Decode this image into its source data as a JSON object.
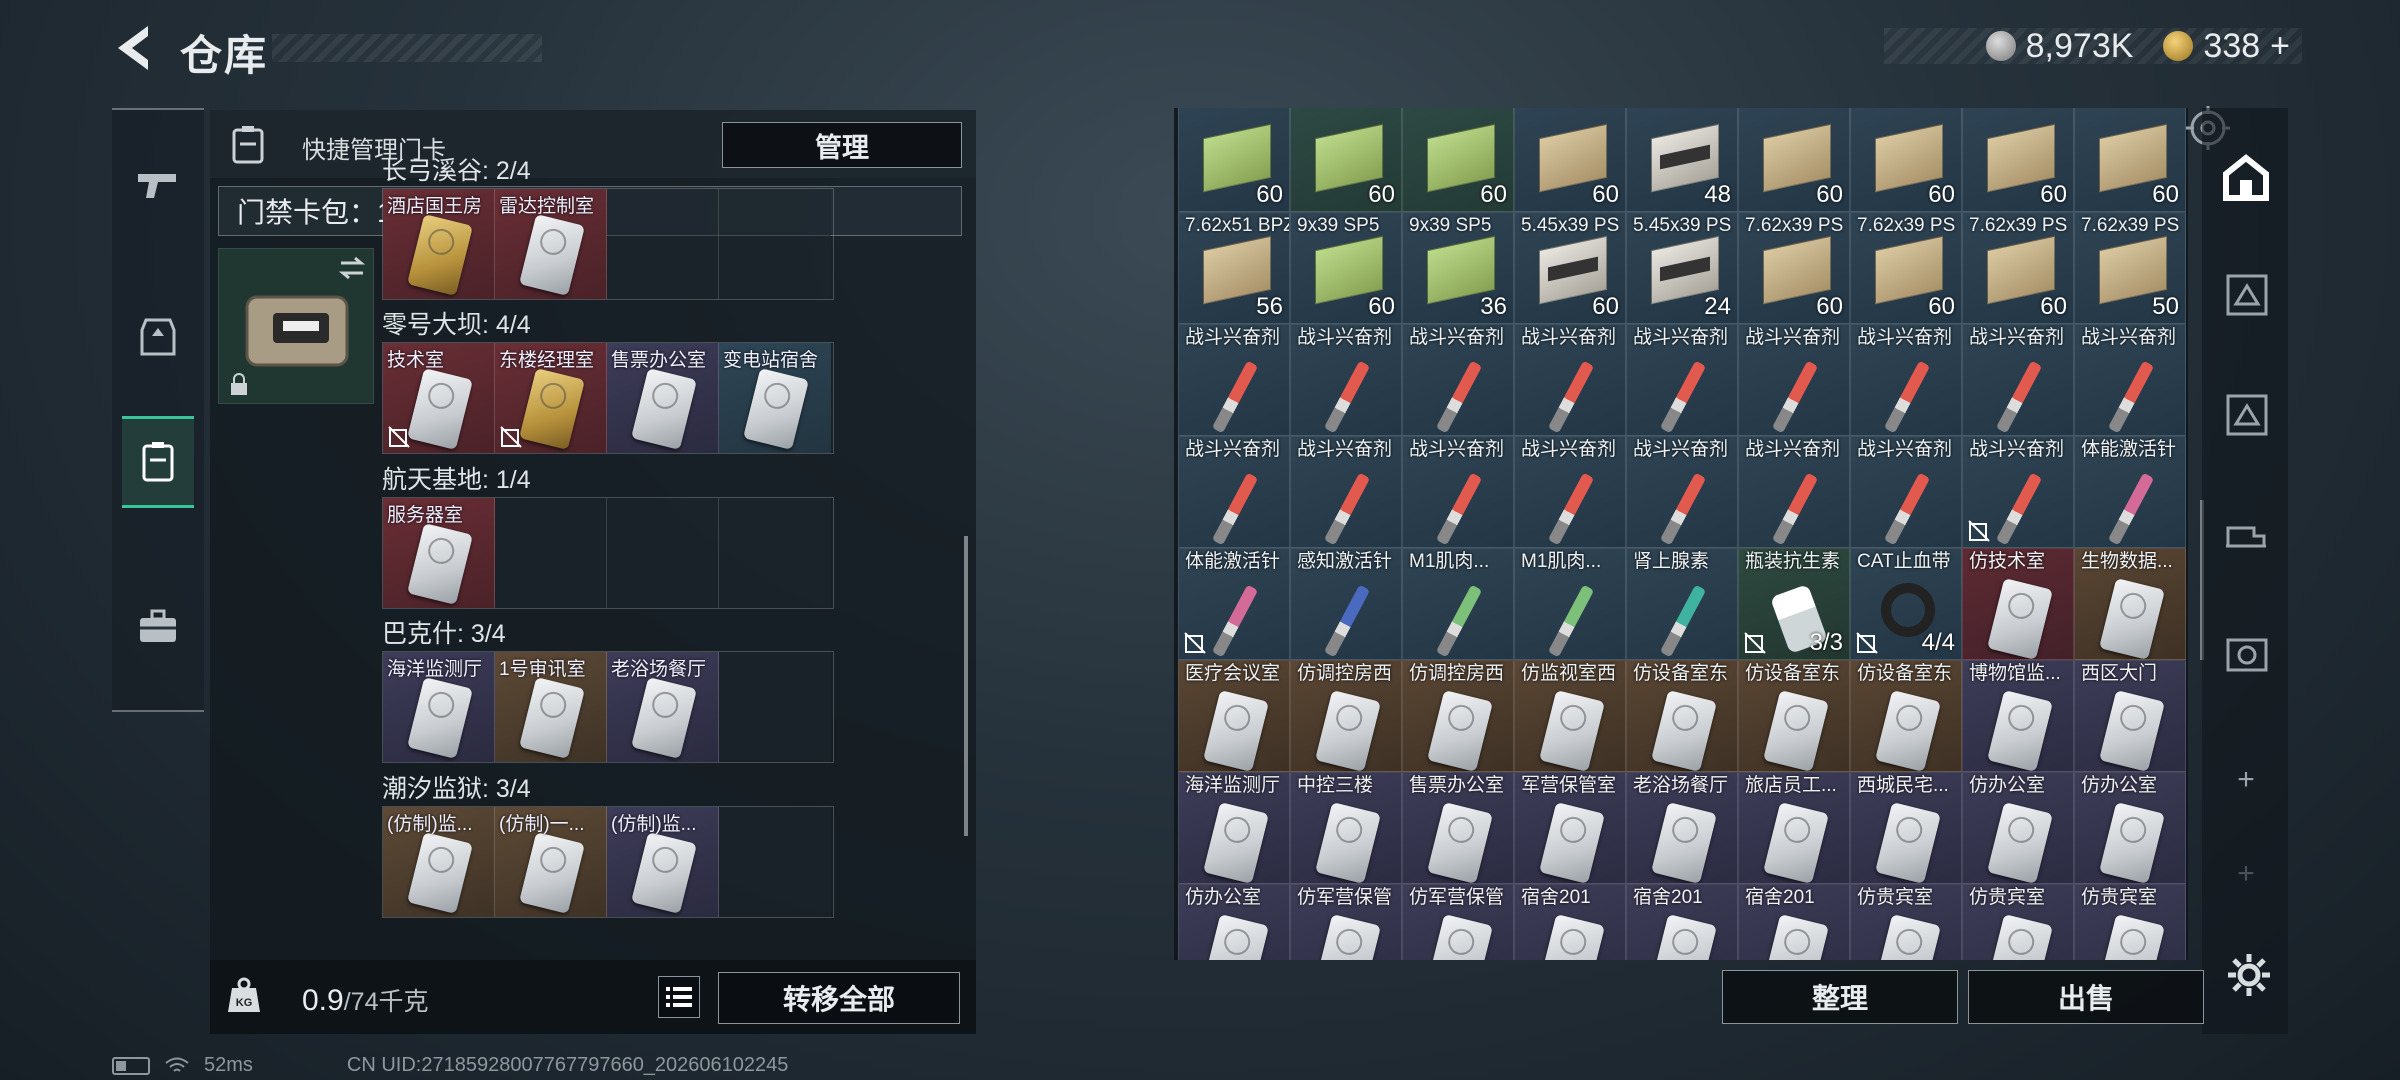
{
  "header": {
    "title": "仓库",
    "silver_value": "8,973K",
    "gold_value": "338",
    "gold_plus": "+"
  },
  "quick_panel": {
    "title": "快捷管理门卡",
    "manage_label": "管理",
    "cardpack_label": "门禁卡包：13/20",
    "help_label": "?"
  },
  "regions": [
    {
      "label": "长弓溪谷: 2/4",
      "slots": [
        {
          "name": "酒店国王房",
          "color": "red",
          "card": "gold",
          "nodrop": false
        },
        {
          "name": "雷达控制室",
          "color": "red",
          "card": "white",
          "nodrop": false
        },
        {
          "name": "",
          "color": "empty"
        },
        {
          "name": "",
          "color": "empty"
        }
      ]
    },
    {
      "label": "零号大坝: 4/4",
      "slots": [
        {
          "name": "技术室",
          "color": "red",
          "card": "white",
          "nodrop": true
        },
        {
          "name": "东楼经理室",
          "color": "red",
          "card": "gold",
          "nodrop": true
        },
        {
          "name": "售票办公室",
          "color": "purple",
          "card": "white",
          "nodrop": false
        },
        {
          "name": "变电站宿舍",
          "color": "blue",
          "card": "white",
          "nodrop": false
        }
      ]
    },
    {
      "label": "航天基地: 1/4",
      "slots": [
        {
          "name": "服务器室",
          "color": "red",
          "card": "white",
          "nodrop": false
        },
        {
          "name": "",
          "color": "empty"
        },
        {
          "name": "",
          "color": "empty"
        },
        {
          "name": "",
          "color": "empty"
        }
      ]
    },
    {
      "label": "巴克什: 3/4",
      "slots": [
        {
          "name": "海洋监测厅",
          "color": "purple",
          "card": "white",
          "nodrop": false
        },
        {
          "name": "1号审讯室",
          "color": "brown",
          "card": "white",
          "nodrop": false
        },
        {
          "name": "老浴场餐厅",
          "color": "purple",
          "card": "white",
          "nodrop": false
        },
        {
          "name": "",
          "color": "empty"
        }
      ]
    },
    {
      "label": "潮汐监狱: 3/4",
      "slots": [
        {
          "name": "(仿制)监...",
          "color": "brown",
          "card": "white",
          "nodrop": false
        },
        {
          "name": "(仿制)一...",
          "color": "brown",
          "card": "white",
          "nodrop": false
        },
        {
          "name": "(仿制)监...",
          "color": "purple",
          "card": "white",
          "nodrop": false
        },
        {
          "name": "",
          "color": "empty"
        }
      ]
    }
  ],
  "bottom": {
    "weight_value": "0.9",
    "weight_unit": "/74千克",
    "transfer_label": "转移全部"
  },
  "status": {
    "ping": "52ms",
    "uid": "CN UID:27185928007767797660_202606102245"
  },
  "inventory": [
    {
      "name": "",
      "count": "60",
      "kind": "ammo",
      "c": "c-blue",
      "variant": "green"
    },
    {
      "name": "",
      "count": "60",
      "kind": "ammo",
      "c": "c-green",
      "variant": "green"
    },
    {
      "name": "",
      "count": "60",
      "kind": "ammo",
      "c": "c-green",
      "variant": "green"
    },
    {
      "name": "",
      "count": "60",
      "kind": "ammo",
      "c": "c-blue",
      "variant": ""
    },
    {
      "name": "",
      "count": "48",
      "kind": "ammo",
      "c": "c-blue",
      "variant": "dark"
    },
    {
      "name": "",
      "count": "60",
      "kind": "ammo",
      "c": "c-blue",
      "variant": ""
    },
    {
      "name": "",
      "count": "60",
      "kind": "ammo",
      "c": "c-blue",
      "variant": ""
    },
    {
      "name": "",
      "count": "60",
      "kind": "ammo",
      "c": "c-blue",
      "variant": ""
    },
    {
      "name": "",
      "count": "60",
      "kind": "ammo",
      "c": "c-blue",
      "variant": ""
    },
    {
      "name": "7.62x51 BPZ",
      "count": "56",
      "kind": "ammo",
      "c": "c-blue",
      "variant": ""
    },
    {
      "name": "9x39 SP5",
      "count": "60",
      "kind": "ammo",
      "c": "c-blue",
      "variant": "green"
    },
    {
      "name": "9x39 SP5",
      "count": "36",
      "kind": "ammo",
      "c": "c-blue",
      "variant": "green"
    },
    {
      "name": "5.45x39 PS",
      "count": "60",
      "kind": "ammo",
      "c": "c-blue",
      "variant": "dark"
    },
    {
      "name": "5.45x39 PS",
      "count": "24",
      "kind": "ammo",
      "c": "c-blue",
      "variant": "dark"
    },
    {
      "name": "7.62x39 PS",
      "count": "60",
      "kind": "ammo",
      "c": "c-blue",
      "variant": ""
    },
    {
      "name": "7.62x39 PS",
      "count": "60",
      "kind": "ammo",
      "c": "c-blue",
      "variant": ""
    },
    {
      "name": "7.62x39 PS",
      "count": "60",
      "kind": "ammo",
      "c": "c-blue",
      "variant": ""
    },
    {
      "name": "7.62x39 PS",
      "count": "50",
      "kind": "ammo",
      "c": "c-blue",
      "variant": ""
    },
    {
      "name": "战斗兴奋剂",
      "count": "",
      "kind": "syringe",
      "c": "c-blue",
      "variant": ""
    },
    {
      "name": "战斗兴奋剂",
      "count": "",
      "kind": "syringe",
      "c": "c-blue",
      "variant": ""
    },
    {
      "name": "战斗兴奋剂",
      "count": "",
      "kind": "syringe",
      "c": "c-blue",
      "variant": ""
    },
    {
      "name": "战斗兴奋剂",
      "count": "",
      "kind": "syringe",
      "c": "c-blue",
      "variant": ""
    },
    {
      "name": "战斗兴奋剂",
      "count": "",
      "kind": "syringe",
      "c": "c-blue",
      "variant": ""
    },
    {
      "name": "战斗兴奋剂",
      "count": "",
      "kind": "syringe",
      "c": "c-blue",
      "variant": ""
    },
    {
      "name": "战斗兴奋剂",
      "count": "",
      "kind": "syringe",
      "c": "c-blue",
      "variant": ""
    },
    {
      "name": "战斗兴奋剂",
      "count": "",
      "kind": "syringe",
      "c": "c-blue",
      "variant": ""
    },
    {
      "name": "战斗兴奋剂",
      "count": "",
      "kind": "syringe",
      "c": "c-blue",
      "variant": ""
    },
    {
      "name": "战斗兴奋剂",
      "count": "",
      "kind": "syringe",
      "c": "c-blue",
      "variant": ""
    },
    {
      "name": "战斗兴奋剂",
      "count": "",
      "kind": "syringe",
      "c": "c-blue",
      "variant": ""
    },
    {
      "name": "战斗兴奋剂",
      "count": "",
      "kind": "syringe",
      "c": "c-blue",
      "variant": ""
    },
    {
      "name": "战斗兴奋剂",
      "count": "",
      "kind": "syringe",
      "c": "c-blue",
      "variant": ""
    },
    {
      "name": "战斗兴奋剂",
      "count": "",
      "kind": "syringe",
      "c": "c-blue",
      "variant": ""
    },
    {
      "name": "战斗兴奋剂",
      "count": "",
      "kind": "syringe",
      "c": "c-blue",
      "variant": ""
    },
    {
      "name": "战斗兴奋剂",
      "count": "",
      "kind": "syringe",
      "c": "c-blue",
      "variant": ""
    },
    {
      "name": "战斗兴奋剂",
      "count": "",
      "kind": "syringe",
      "c": "c-blue",
      "variant": "",
      "nodrop": true
    },
    {
      "name": "体能激活针",
      "count": "",
      "kind": "syringe",
      "c": "c-blue",
      "variant": "pink"
    },
    {
      "name": "体能激活针",
      "count": "",
      "kind": "syringe",
      "c": "c-blue",
      "variant": "pink",
      "nodrop": true
    },
    {
      "name": "感知激活针",
      "count": "",
      "kind": "syringe",
      "c": "c-blue",
      "variant": "blue"
    },
    {
      "name": "M1肌肉...",
      "count": "",
      "kind": "syringe",
      "c": "c-blue",
      "variant": "lgreen"
    },
    {
      "name": "M1肌肉...",
      "count": "",
      "kind": "syringe",
      "c": "c-blue",
      "variant": "lgreen"
    },
    {
      "name": "肾上腺素",
      "count": "",
      "kind": "syringe",
      "c": "c-blue",
      "variant": "teal"
    },
    {
      "name": "瓶装抗生素",
      "count": "3/3",
      "kind": "bottle",
      "c": "c-dgreen",
      "variant": "",
      "nodrop": true
    },
    {
      "name": "CAT止血带",
      "count": "4/4",
      "kind": "tourniquet",
      "c": "c-blue",
      "variant": "",
      "nodrop": true
    },
    {
      "name": "仿技术室",
      "count": "",
      "kind": "card",
      "c": "c-red",
      "variant": "white"
    },
    {
      "name": "生物数据...",
      "count": "",
      "kind": "card",
      "c": "c-brown",
      "variant": "white"
    },
    {
      "name": "医疗会议室",
      "count": "",
      "kind": "card",
      "c": "c-brown",
      "variant": "white"
    },
    {
      "name": "仿调控房西",
      "count": "",
      "kind": "card",
      "c": "c-brown",
      "variant": "white"
    },
    {
      "name": "仿调控房西",
      "count": "",
      "kind": "card",
      "c": "c-brown",
      "variant": "white"
    },
    {
      "name": "仿监视室西",
      "count": "",
      "kind": "card",
      "c": "c-brown",
      "variant": "white"
    },
    {
      "name": "仿设备室东",
      "count": "",
      "kind": "card",
      "c": "c-brown",
      "variant": "white"
    },
    {
      "name": "仿设备室东",
      "count": "",
      "kind": "card",
      "c": "c-brown",
      "variant": "white"
    },
    {
      "name": "仿设备室东",
      "count": "",
      "kind": "card",
      "c": "c-brown",
      "variant": "white"
    },
    {
      "name": "博物馆监...",
      "count": "",
      "kind": "card",
      "c": "c-purple",
      "variant": "white"
    },
    {
      "name": "西区大门",
      "count": "",
      "kind": "card",
      "c": "c-purple",
      "variant": "white"
    },
    {
      "name": "海洋监测厅",
      "count": "",
      "kind": "card",
      "c": "c-purple",
      "variant": "white"
    },
    {
      "name": "中控三楼",
      "count": "",
      "kind": "card",
      "c": "c-purple",
      "variant": "white"
    },
    {
      "name": "售票办公室",
      "count": "",
      "kind": "card",
      "c": "c-purple",
      "variant": "white"
    },
    {
      "name": "军营保管室",
      "count": "",
      "kind": "card",
      "c": "c-purple",
      "variant": "white"
    },
    {
      "name": "老浴场餐厅",
      "count": "",
      "kind": "card",
      "c": "c-purple",
      "variant": "white"
    },
    {
      "name": "旅店员工...",
      "count": "",
      "kind": "card",
      "c": "c-purple",
      "variant": "white"
    },
    {
      "name": "西城民宅...",
      "count": "",
      "kind": "card",
      "c": "c-purple",
      "variant": "white"
    },
    {
      "name": "仿办公室",
      "count": "",
      "kind": "card",
      "c": "c-purple",
      "variant": "white"
    },
    {
      "name": "仿办公室",
      "count": "",
      "kind": "card",
      "c": "c-purple",
      "variant": "white"
    },
    {
      "name": "仿办公室",
      "count": "",
      "kind": "card",
      "c": "c-purple",
      "variant": "white"
    },
    {
      "name": "仿军营保管",
      "count": "",
      "kind": "card",
      "c": "c-purple",
      "variant": "white"
    },
    {
      "name": "仿军营保管",
      "count": "",
      "kind": "card",
      "c": "c-purple",
      "variant": "white"
    },
    {
      "name": "宿舍201",
      "count": "",
      "kind": "card",
      "c": "c-purple",
      "variant": "white"
    },
    {
      "name": "宿舍201",
      "count": "",
      "kind": "card",
      "c": "c-purple",
      "variant": "white"
    },
    {
      "name": "宿舍201",
      "count": "",
      "kind": "card",
      "c": "c-purple",
      "variant": "white"
    },
    {
      "name": "仿贵宾室",
      "count": "",
      "kind": "card",
      "c": "c-purple",
      "variant": "white"
    },
    {
      "name": "仿贵宾室",
      "count": "",
      "kind": "card",
      "c": "c-purple",
      "variant": "white"
    },
    {
      "name": "仿贵宾室",
      "count": "",
      "kind": "card",
      "c": "c-purple",
      "variant": "white"
    }
  ],
  "right_actions": {
    "sort_label": "整理",
    "sell_label": "出售",
    "side_plus_1": "+",
    "side_plus_2": "+"
  },
  "colors": {
    "accent": "#39c49a",
    "panel": "#12191f"
  }
}
